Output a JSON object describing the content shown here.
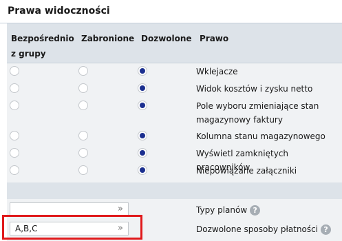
{
  "section": {
    "title": "Prawa widoczności"
  },
  "table": {
    "headers": [
      "Bezpośrednio z grupy",
      "Zabronione",
      "Dozwolone",
      "Prawo"
    ],
    "rows": [
      {
        "label": "Wklejacze",
        "selected": 2
      },
      {
        "label": "Widok kosztów i zysku netto",
        "selected": 2
      },
      {
        "label": "Pole wyboru zmieniające stan magazynowy faktury",
        "selected": 2
      },
      {
        "label": "Kolumna stanu magazynowego",
        "selected": 2
      },
      {
        "label": "Wyświetl zamkniętych pracowników",
        "selected": 2
      },
      {
        "label": "Niepowiązane załączniki",
        "selected": 2
      }
    ]
  },
  "pickers": [
    {
      "value": "",
      "button": "»",
      "label": "Typy planów",
      "help": "?"
    },
    {
      "value": "A,B,C",
      "button": "»",
      "label": "Dozwolone sposoby płatności",
      "help": "?"
    }
  ],
  "colors": {
    "radio_checked": "#1b2f8f",
    "highlight": "#e0191b",
    "header_bg": "#dde3e9"
  },
  "icons": {
    "help": "question-circle-icon",
    "picker": "double-chevron-right-icon"
  }
}
